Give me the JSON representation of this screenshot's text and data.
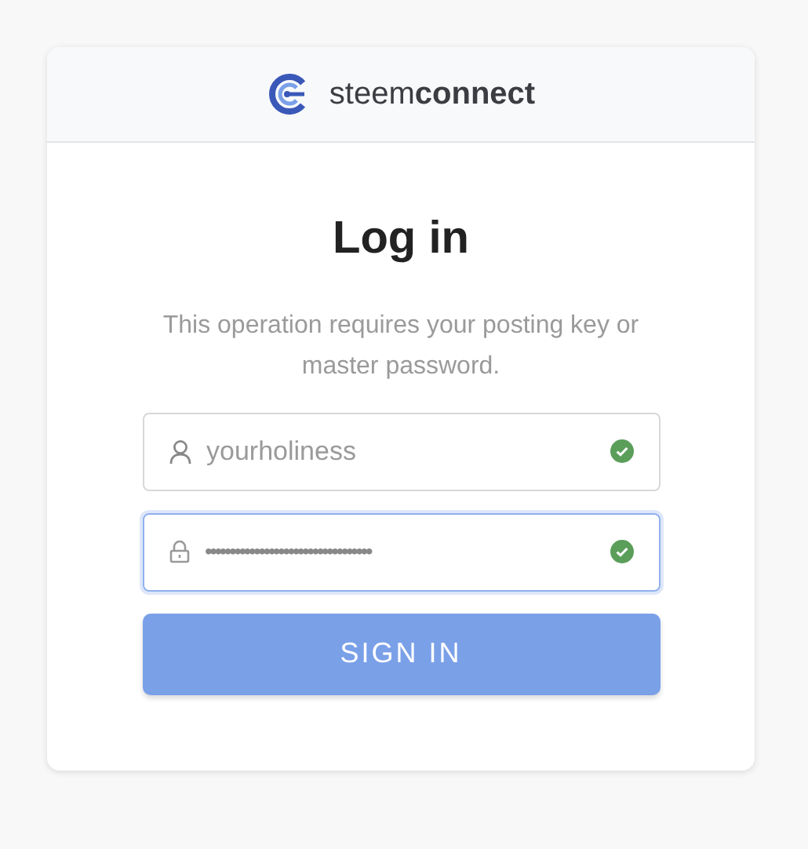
{
  "header": {
    "brand_light": "steem",
    "brand_bold": "connect"
  },
  "title": "Log in",
  "description": "This operation requires your posting key or master password.",
  "fields": [
    {
      "kind": "username",
      "value": "yourholiness",
      "valid": true,
      "focused": false
    },
    {
      "kind": "password",
      "value": "••••••••••••••••••••••••••••••••••",
      "valid": true,
      "focused": true
    }
  ],
  "button": "SIGN IN"
}
